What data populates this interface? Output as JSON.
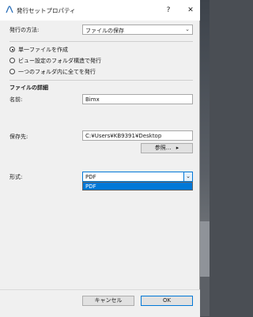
{
  "window": {
    "title": "発行セットプロパティ",
    "help_glyph": "?",
    "close_glyph": "✕"
  },
  "publish_method": {
    "label": "発行の方法:",
    "value": "ファイルの保存",
    "arrow": "⌄"
  },
  "radio_options": [
    {
      "label": "単一ファイルを作成",
      "selected": true
    },
    {
      "label": "ビュー設定のフォルダ構造で発行",
      "selected": false
    },
    {
      "label": "一つのフォルダ内に全てを発行",
      "selected": false
    }
  ],
  "file_details": {
    "section_label": "ファイルの詳細",
    "name_label": "名前:",
    "name_value": "Bimx",
    "save_to_label": "保存先:",
    "save_to_value": "C:¥Users¥KB9391¥Desktop",
    "browse_label": "参照...",
    "browse_arrow": "▸",
    "format_label": "形式:",
    "format_value": "PDF",
    "format_arrow": "⌄",
    "format_options": [
      "PDF"
    ]
  },
  "footer": {
    "cancel_label": "キャンセル",
    "ok_label": "OK"
  },
  "colors": {
    "accent": "#0078d7",
    "dialog_bg": "#f0f0f0"
  }
}
